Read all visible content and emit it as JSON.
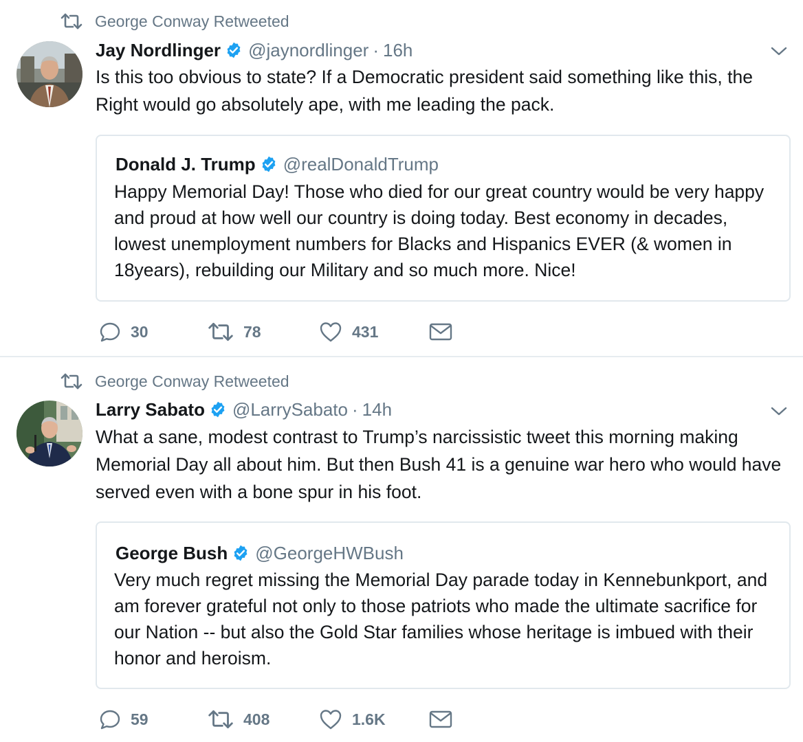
{
  "tweets": [
    {
      "retweeted_by": "George Conway Retweeted",
      "author": {
        "name": "Jay Nordlinger",
        "handle": "@jaynordlinger",
        "time": "16h"
      },
      "text": "Is this too obvious to state? If a Democratic president said something like this, the Right would go absolutely ape, with me leading the pack.",
      "quote": {
        "name": "Donald J. Trump",
        "handle": "@realDonaldTrump",
        "text": "Happy Memorial Day! Those who died for our great country would be very happy and proud at how well our country is doing today. Best economy in decades, lowest unemployment numbers for Blacks and Hispanics EVER (& women in 18years), rebuilding our Military and so much more. Nice!"
      },
      "stats": {
        "replies": "30",
        "retweets": "78",
        "likes": "431"
      }
    },
    {
      "retweeted_by": "George Conway Retweeted",
      "author": {
        "name": "Larry Sabato",
        "handle": "@LarrySabato",
        "time": "14h"
      },
      "text": "What a sane, modest contrast to Trump’s narcissistic tweet this morning making Memorial Day all about him. But then Bush 41 is a genuine war hero who would have served even with a bone spur in his foot.",
      "quote": {
        "name": "George Bush",
        "handle": "@GeorgeHWBush",
        "text": "Very much regret missing the Memorial Day parade today in Kennebunkport, and am forever grateful not only to those patriots who made the ultimate sacrifice for our Nation -- but also the Gold Star families whose heritage is imbued with their honor and heroism."
      },
      "stats": {
        "replies": "59",
        "retweets": "408",
        "likes": "1.6K"
      }
    }
  ],
  "icons": {
    "retweet": "retweet-icon",
    "verified": "verified-badge-icon",
    "caret": "chevron-down-icon",
    "reply": "reply-icon",
    "like": "heart-icon",
    "dm": "envelope-icon"
  },
  "colors": {
    "verified": "#1da1f2",
    "secondary_text": "#657786",
    "border": "#e1e8ed"
  }
}
